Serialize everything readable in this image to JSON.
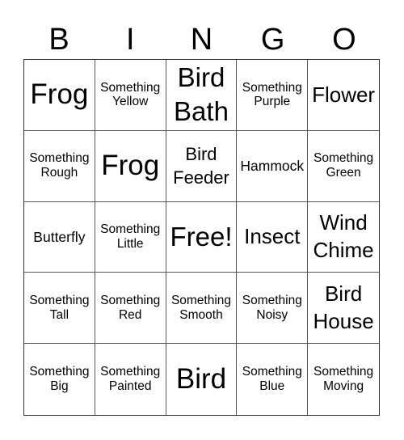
{
  "header": {
    "letters": [
      "B",
      "I",
      "N",
      "G",
      "O"
    ]
  },
  "cells": [
    {
      "text": "Frog",
      "size": "s6"
    },
    {
      "text": "Something\nYellow",
      "size": "s1"
    },
    {
      "text": "Bird\nBath",
      "size": "s5"
    },
    {
      "text": "Something\nPurple",
      "size": "s1"
    },
    {
      "text": "Flower",
      "size": "s4"
    },
    {
      "text": "Something\nRough",
      "size": "s1"
    },
    {
      "text": "Frog",
      "size": "s6"
    },
    {
      "text": "Bird\nFeeder",
      "size": "s3"
    },
    {
      "text": "Hammock",
      "size": "s2"
    },
    {
      "text": "Something\nGreen",
      "size": "s1"
    },
    {
      "text": "Butterfly",
      "size": "s2"
    },
    {
      "text": "Something\nLittle",
      "size": "s1"
    },
    {
      "text": "Free!",
      "size": "s5"
    },
    {
      "text": "Insect",
      "size": "s4"
    },
    {
      "text": "Wind\nChime",
      "size": "s4"
    },
    {
      "text": "Something\nTall",
      "size": "s1"
    },
    {
      "text": "Something\nRed",
      "size": "s1"
    },
    {
      "text": "Something\nSmooth",
      "size": "s1"
    },
    {
      "text": "Something\nNoisy",
      "size": "s1"
    },
    {
      "text": "Bird\nHouse",
      "size": "s4"
    },
    {
      "text": "Something\nBig",
      "size": "s1"
    },
    {
      "text": "Something\nPainted",
      "size": "s1"
    },
    {
      "text": "Bird",
      "size": "s6"
    },
    {
      "text": "Something\nBlue",
      "size": "s1"
    },
    {
      "text": "Something\nMoving",
      "size": "s1"
    }
  ]
}
